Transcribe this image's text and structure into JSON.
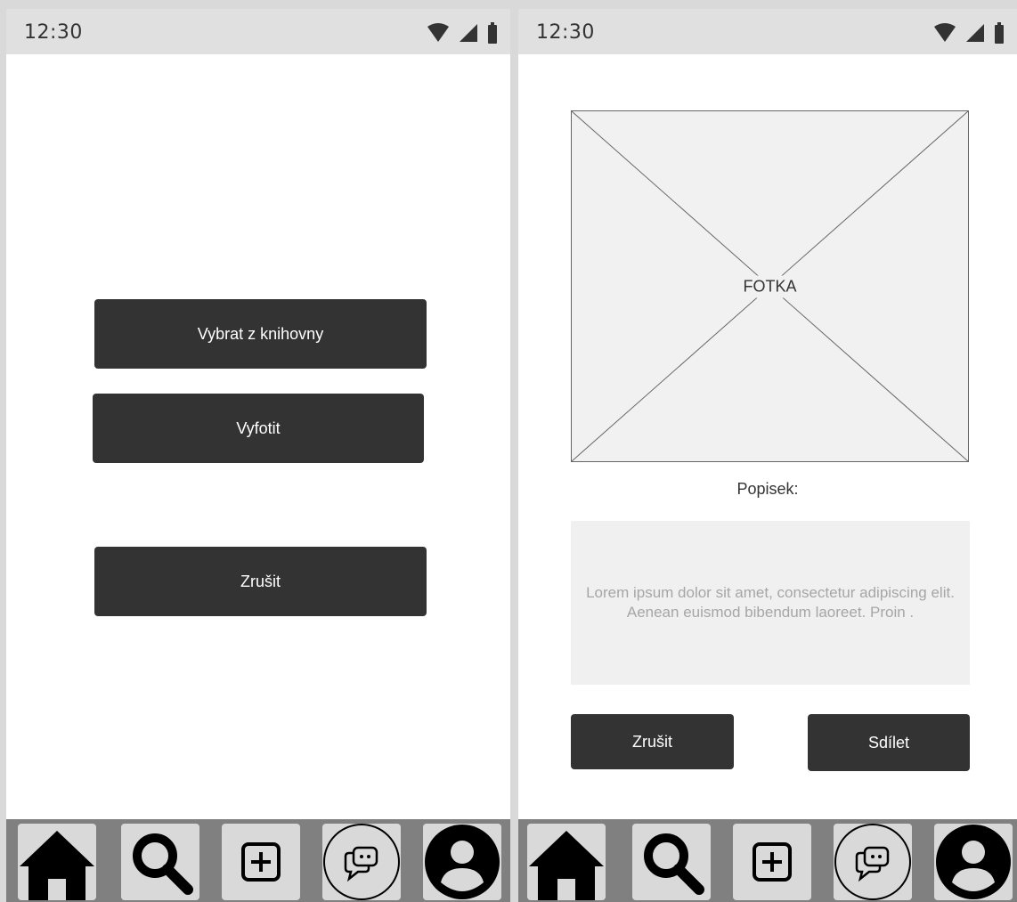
{
  "screens": [
    {
      "status_bar": {
        "time": "12:30",
        "icons": [
          "wifi-icon",
          "signal-icon",
          "battery-icon"
        ]
      },
      "buttons": {
        "pick_from_library": "Vybrat z knihovny",
        "take_photo": "Vyfotit",
        "cancel": "Zrušit"
      },
      "nav": [
        "home-icon",
        "search-icon",
        "add-icon",
        "chat-icon",
        "profile-icon"
      ]
    },
    {
      "status_bar": {
        "time": "12:30",
        "icons": [
          "wifi-icon",
          "signal-icon",
          "battery-icon"
        ]
      },
      "photo_placeholder": "FOTKA",
      "caption_label": "Popisek:",
      "caption_text": "Lorem ipsum dolor sit amet, consectetur adipiscing elit. Aenean euismod bibendum laoreet. Proin .",
      "buttons": {
        "cancel": "Zrušit",
        "share": "Sdílet"
      },
      "nav": [
        "home-icon",
        "search-icon",
        "add-icon",
        "chat-icon",
        "profile-icon"
      ]
    }
  ],
  "colors": {
    "button_bg": "#333333",
    "button_text": "#ffffff",
    "status_bar": "#e0e0e0",
    "nav_bar": "#808080",
    "nav_tile": "#d9d9d9"
  }
}
